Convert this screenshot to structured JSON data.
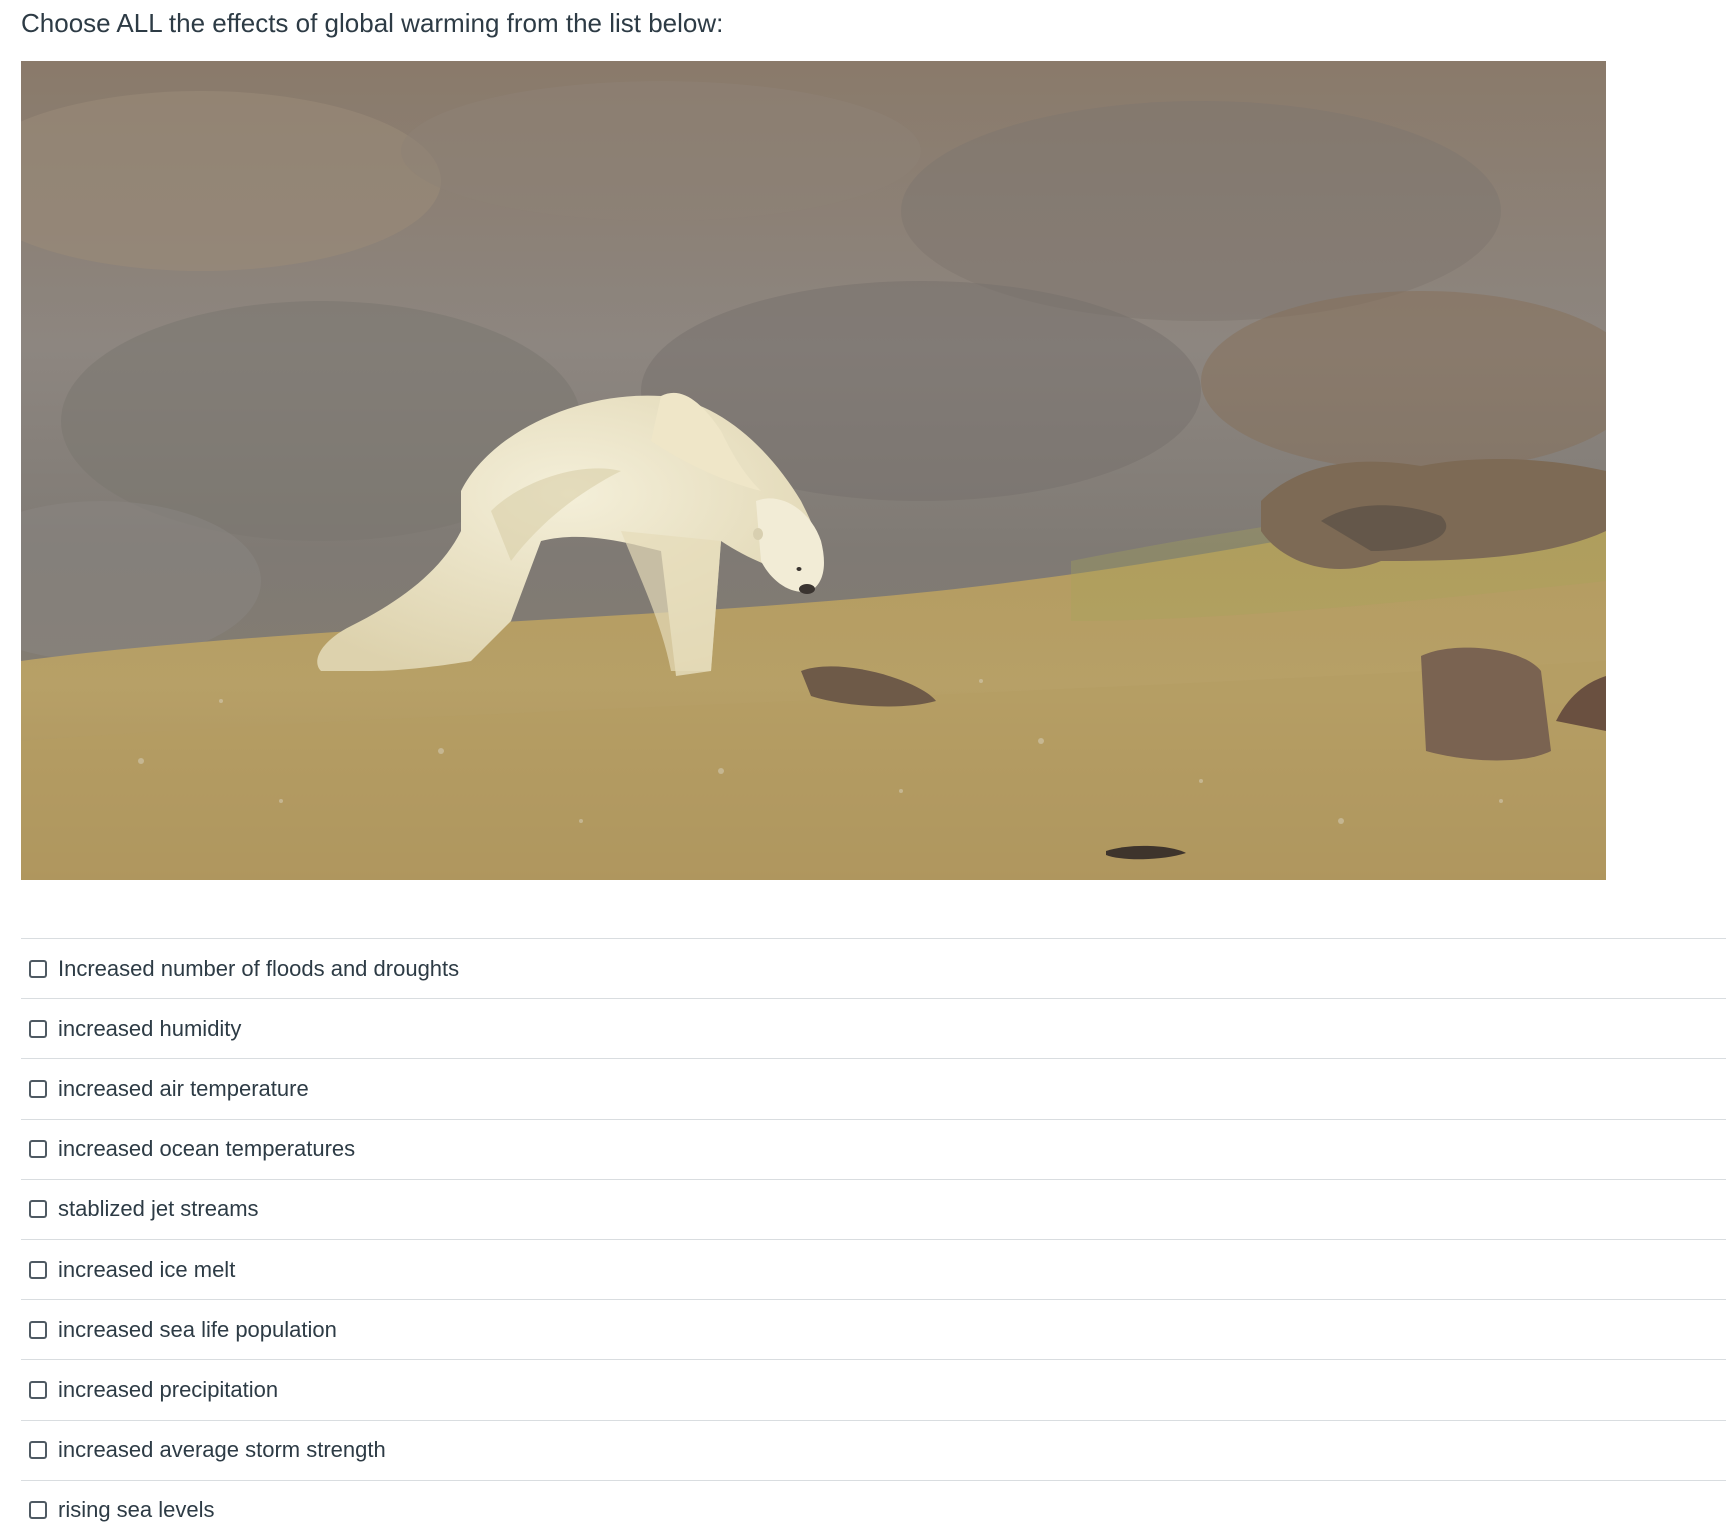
{
  "question": {
    "text": "Choose ALL the effects of global warming from the list below:"
  },
  "image": {
    "subject": "polar-bear-photo"
  },
  "answers": [
    {
      "label": "Increased number of floods and droughts",
      "checked": false
    },
    {
      "label": "increased humidity",
      "checked": false
    },
    {
      "label": "increased air temperature",
      "checked": false
    },
    {
      "label": "increased ocean temperatures",
      "checked": false
    },
    {
      "label": "stablized jet streams",
      "checked": false
    },
    {
      "label": "increased ice melt",
      "checked": false
    },
    {
      "label": "increased sea life population",
      "checked": false
    },
    {
      "label": "increased precipitation",
      "checked": false
    },
    {
      "label": "increased average storm strength",
      "checked": false
    },
    {
      "label": "rising sea levels",
      "checked": false
    }
  ],
  "colors": {
    "text": "#2d3b45",
    "divider": "#d9dde0",
    "checkbox_border": "#4f5a63"
  }
}
